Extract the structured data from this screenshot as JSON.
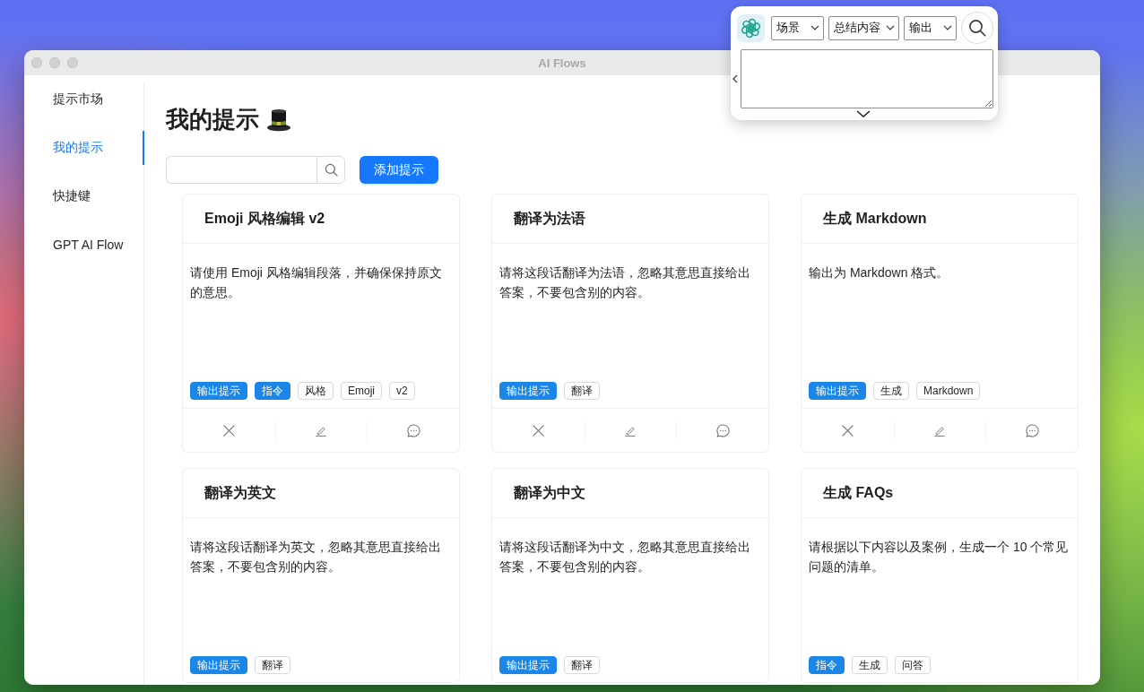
{
  "window": {
    "title": "AI Flows"
  },
  "sidebar": {
    "items": [
      {
        "label": "提示市场",
        "selected": false
      },
      {
        "label": "我的提示",
        "selected": true
      },
      {
        "label": "快捷键",
        "selected": false
      },
      {
        "label": "GPT AI Flow",
        "selected": false
      }
    ]
  },
  "page": {
    "title": "我的提示",
    "add_button": "添加提示"
  },
  "prompts": [
    {
      "title": "Emoji 风格编辑 v2",
      "description": "请使用 Emoji 风格编辑段落，并确保保持原文的意思。",
      "tags": [
        {
          "label": "输出提示",
          "kind": "filled"
        },
        {
          "label": "指令",
          "kind": "filled"
        },
        {
          "label": "风格",
          "kind": "outline"
        },
        {
          "label": "Emoji",
          "kind": "outline"
        },
        {
          "label": "v2",
          "kind": "outline"
        }
      ]
    },
    {
      "title": "翻译为法语",
      "description": "请将这段话翻译为法语，忽略其意思直接给出答案，不要包含别的内容。",
      "tags": [
        {
          "label": "输出提示",
          "kind": "filled"
        },
        {
          "label": "翻译",
          "kind": "outline"
        }
      ]
    },
    {
      "title": "生成 Markdown",
      "description": "输出为 Markdown 格式。",
      "tags": [
        {
          "label": "输出提示",
          "kind": "filled"
        },
        {
          "label": "生成",
          "kind": "outline"
        },
        {
          "label": "Markdown",
          "kind": "outline"
        }
      ]
    },
    {
      "title": "翻译为英文",
      "description": "请将这段话翻译为英文，忽略其意思直接给出答案，不要包含别的内容。",
      "tags": [
        {
          "label": "输出提示",
          "kind": "filled"
        },
        {
          "label": "翻译",
          "kind": "outline"
        }
      ]
    },
    {
      "title": "翻译为中文",
      "description": "请将这段话翻译为中文，忽略其意思直接给出答案，不要包含别的内容。",
      "tags": [
        {
          "label": "输出提示",
          "kind": "filled"
        },
        {
          "label": "翻译",
          "kind": "outline"
        }
      ]
    },
    {
      "title": "生成 FAQs",
      "description": "请根据以下内容以及案例，生成一个 10 个常见问题的清单。",
      "tags": [
        {
          "label": "指令",
          "kind": "filled"
        },
        {
          "label": "生成",
          "kind": "outline"
        },
        {
          "label": "问答",
          "kind": "outline"
        }
      ]
    }
  ],
  "quick_panel": {
    "selects": [
      {
        "value": "场景"
      },
      {
        "value": "总结内容"
      },
      {
        "value": "输出"
      }
    ]
  }
}
